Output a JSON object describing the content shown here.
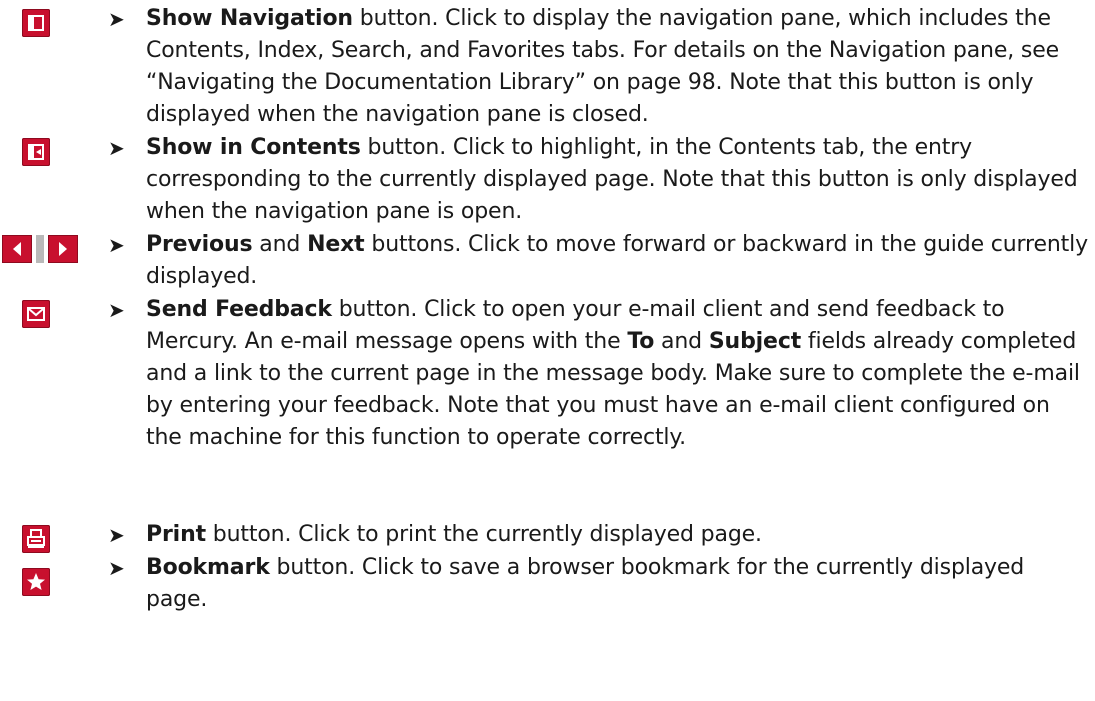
{
  "bullet_glyph": "➤",
  "items": [
    {
      "icon": "show-navigation-icon",
      "name": "Show Navigation",
      "desc": " button. Click to display the navigation pane, which includes the Contents, Index, Search, and Favorites tabs. For details on the Navigation pane, see “Navigating the Documentation Library” on page 98. Note that this button is only displayed when the navigation pane is closed."
    },
    {
      "icon": "show-in-contents-icon",
      "name": "Show in Contents",
      "desc": " button. Click to highlight, in the Contents tab, the entry corresponding to the currently displayed page. Note that this button is only displayed when the navigation pane is open."
    },
    {
      "icon": "previous-next-icons",
      "name": "Previous",
      "joiner": " and ",
      "name2": "Next",
      "desc": " buttons. Click to move forward or backward in the guide currently displayed."
    },
    {
      "icon": "send-feedback-icon",
      "name": "Send Feedback",
      "desc_a": " button. Click to open your e-mail client and send feedback to Mercury. An e-mail message opens with the ",
      "bold_to": "To",
      "and": " and ",
      "bold_subject": "Subject",
      "desc_b": " fields already completed and a link to the current page in the message body. Make sure to complete the e-mail by entering your feedback. Note that you must have an e-mail client configured on the machine for this function to operate correctly."
    },
    {
      "icon": "print-icon",
      "name": "Print",
      "desc": " button. Click to print the currently displayed page."
    },
    {
      "icon": "bookmark-icon",
      "name": "Bookmark",
      "desc": " button. Click to save a browser bookmark for the currently displayed page."
    }
  ],
  "colors": {
    "icon_red": "#c8102e",
    "icon_border": "#8e0a1f",
    "separator_gray": "#b9b9b9",
    "text": "#1a1a1a"
  }
}
